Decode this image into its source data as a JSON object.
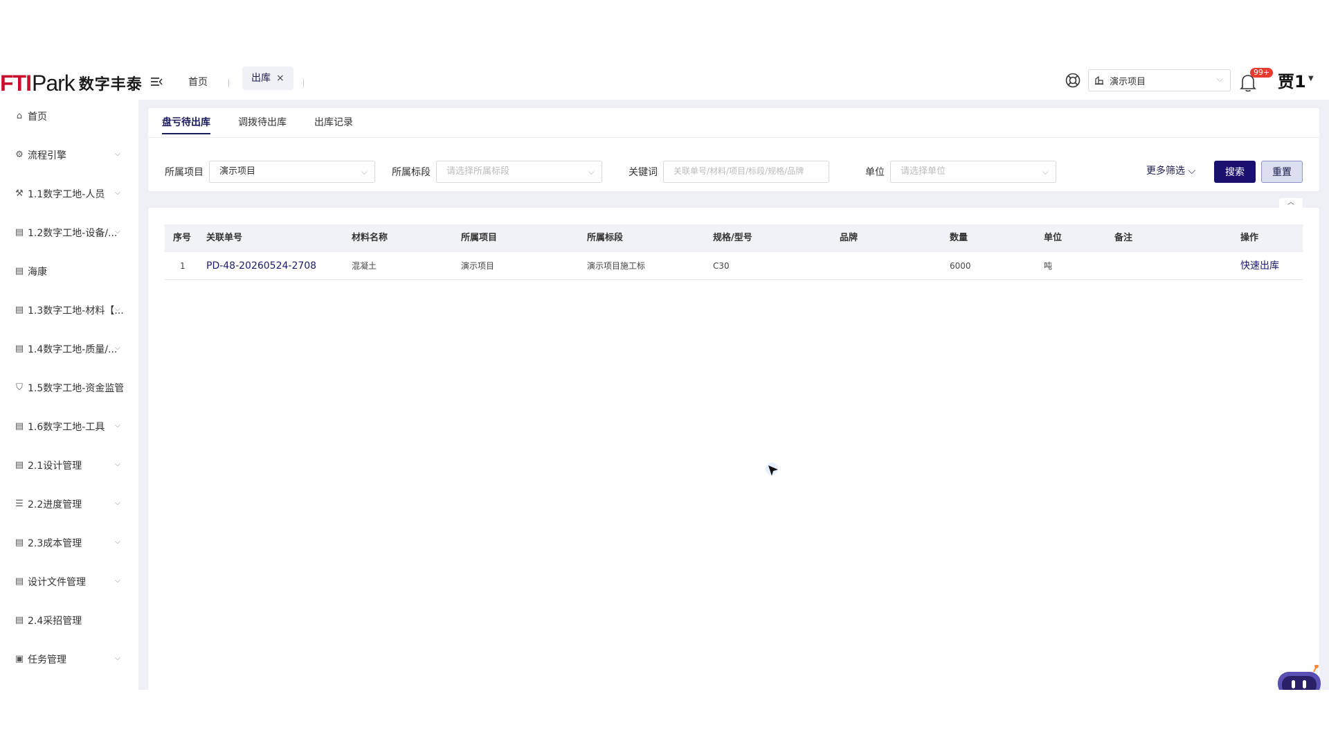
{
  "header": {
    "logo_mark": "FTI",
    "logo_park": "Park",
    "logo_cn": "数字丰泰",
    "tab_home": "首页",
    "tab_active": "出库",
    "tab_close": "×",
    "project_select": "演示项目",
    "badge": "99+",
    "user": "贾1"
  },
  "sidebar": {
    "items": [
      {
        "label": "首页",
        "icon": "home-icon",
        "chevron": false
      },
      {
        "label": "流程引擎",
        "icon": "flow-icon",
        "chevron": true
      },
      {
        "label": "1.1数字工地-人员",
        "icon": "people-icon",
        "chevron": true
      },
      {
        "label": "1.2数字工地-设备/...",
        "icon": "document-icon",
        "chevron": true
      },
      {
        "label": "海康",
        "icon": "document-icon",
        "chevron": false
      },
      {
        "label": "1.3数字工地-材料【...",
        "icon": "document-icon",
        "chevron": true
      },
      {
        "label": "1.4数字工地-质量/...",
        "icon": "document-icon",
        "chevron": true
      },
      {
        "label": "1.5数字工地-资金监管",
        "icon": "shield-icon",
        "chevron": false
      },
      {
        "label": "1.6数字工地-工具",
        "icon": "document-icon",
        "chevron": true
      },
      {
        "label": "2.1设计管理",
        "icon": "document-icon",
        "chevron": true
      },
      {
        "label": "2.2进度管理",
        "icon": "gantt-icon",
        "chevron": true
      },
      {
        "label": "2.3成本管理",
        "icon": "document-icon",
        "chevron": true
      },
      {
        "label": "设计文件管理",
        "icon": "document-icon",
        "chevron": true
      },
      {
        "label": "2.4采招管理",
        "icon": "document-icon",
        "chevron": false
      },
      {
        "label": "任务管理",
        "icon": "briefcase-icon",
        "chevron": true
      }
    ]
  },
  "tabs": [
    "盘亏待出库",
    "调拨待出库",
    "出库记录"
  ],
  "filters": {
    "project_label": "所属项目",
    "project_value": "演示项目",
    "section_label": "所属标段",
    "section_placeholder": "请选择所属标段",
    "keyword_label": "关键词",
    "keyword_placeholder": "关联单号/材料/项目/标段/规格/品牌",
    "unit_label": "单位",
    "unit_placeholder": "请选择单位",
    "more_filter": "更多筛选",
    "search_button": "搜索",
    "reset_button": "重置"
  },
  "table": {
    "columns": [
      "序号",
      "关联单号",
      "材料名称",
      "所属项目",
      "所属标段",
      "规格/型号",
      "品牌",
      "数量",
      "单位",
      "备注",
      "操作"
    ],
    "rows": [
      {
        "index": "1",
        "order_no": "PD-48-20260524-2708",
        "material": "混凝土",
        "project": "演示项目",
        "section": "演示项目施工标",
        "spec": "C30",
        "brand": "",
        "quantity": "6000",
        "unit": "吨",
        "remark": "",
        "action": "快速出库"
      }
    ]
  },
  "colors": {
    "primary": "#1a1070",
    "accent_red": "#c8102e",
    "badge_red": "#e63b2e",
    "background": "#eef0f5"
  }
}
